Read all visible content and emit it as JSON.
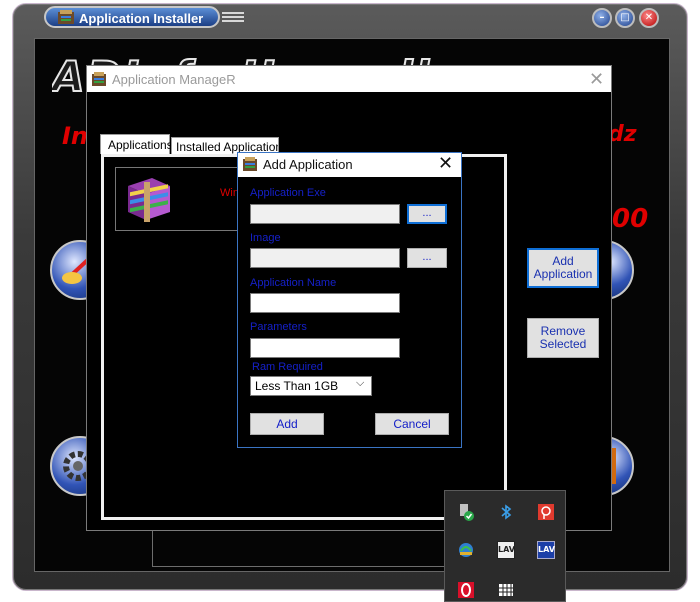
{
  "installer": {
    "title": "Application Installer",
    "logo_text": "ADInfo Unspell",
    "red_left": "In",
    "red_right": "dz",
    "red_number": "00"
  },
  "manager": {
    "title": "Application ManageR",
    "close_glyph": "✕",
    "tabs": [
      {
        "label": "Applications",
        "active": true
      },
      {
        "label": "Installed Applications",
        "active": false
      }
    ],
    "entries": [
      {
        "icon": "winrar-icon",
        "label_partial": "Win"
      }
    ],
    "buttons": {
      "add": "Add Application",
      "remove": "Remove Selected"
    }
  },
  "add_dialog": {
    "title": "Add Application",
    "close_glyph": "✕",
    "fields": {
      "exe_label": "Application Exe",
      "exe_value": "",
      "image_label": "Image",
      "image_value": "",
      "name_label": "Application Name",
      "name_value": "",
      "params_label": "Parameters",
      "params_value": "",
      "ram_label": "Ram Required",
      "ram_value": "Less Than 1GB"
    },
    "browse_label": "...",
    "add_button": "Add",
    "cancel_button": "Cancel"
  },
  "tray": {
    "icons": [
      "usb-safely-remove-icon",
      "bluetooth-icon",
      "acrobat-icon",
      "network-update-icon",
      "lav-filters-icon",
      "lav-filters-blue-icon",
      "opera-icon",
      "grid-app-icon"
    ],
    "lav_text": "LAV"
  },
  "colors": {
    "dialog_label_blue": "#1520c8",
    "red_accent": "#e00000",
    "focus_blue": "#0f6fd6"
  }
}
